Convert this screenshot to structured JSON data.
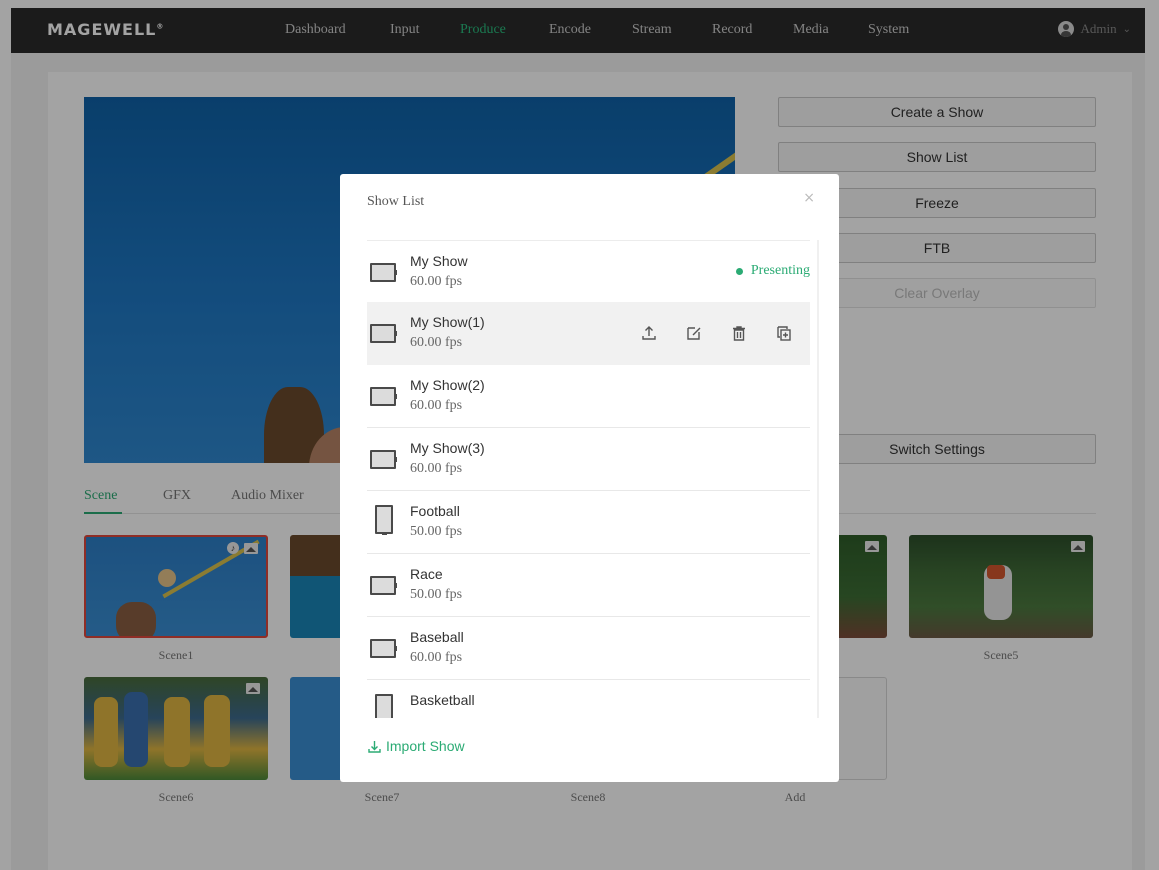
{
  "header": {
    "logo": "MAGEWELL",
    "logo_mark": "®",
    "nav": [
      {
        "label": "Dashboard",
        "active": false
      },
      {
        "label": "Input",
        "active": false
      },
      {
        "label": "Produce",
        "active": true
      },
      {
        "label": "Encode",
        "active": false
      },
      {
        "label": "Stream",
        "active": false
      },
      {
        "label": "Record",
        "active": false
      },
      {
        "label": "Media",
        "active": false
      },
      {
        "label": "System",
        "active": false
      }
    ],
    "user": "Admin"
  },
  "side_buttons": {
    "create_show": "Create a Show",
    "show_list": "Show List",
    "freeze": "Freeze",
    "ftb": "FTB",
    "clear_overlay": "Clear Overlay",
    "switch_settings": "Switch Settings"
  },
  "tabs": [
    "Scene",
    "GFX",
    "Audio Mixer"
  ],
  "scenes": {
    "scene1": "Scene1",
    "scene5": "Scene5",
    "scene6": "Scene6",
    "scene7": "Scene7",
    "scene8": "Scene8",
    "add": "Add"
  },
  "modal": {
    "title": "Show List",
    "close": "×",
    "presenting": "Presenting",
    "import": "Import Show",
    "shows": [
      {
        "name": "My Show",
        "fps": "60.00 fps",
        "orientation": "landscape"
      },
      {
        "name": "My Show(1)",
        "fps": "60.00 fps",
        "orientation": "landscape"
      },
      {
        "name": "My Show(2)",
        "fps": "60.00 fps",
        "orientation": "landscape"
      },
      {
        "name": "My Show(3)",
        "fps": "60.00 fps",
        "orientation": "landscape"
      },
      {
        "name": "Football",
        "fps": "50.00 fps",
        "orientation": "portrait"
      },
      {
        "name": "Race",
        "fps": "50.00 fps",
        "orientation": "landscape"
      },
      {
        "name": "Baseball",
        "fps": "60.00 fps",
        "orientation": "landscape"
      },
      {
        "name": "Basketball",
        "fps": "",
        "orientation": "portrait"
      }
    ]
  },
  "colors": {
    "accent": "#2bab74",
    "nav_bg": "#2b2b2b",
    "scene_selected_border": "#e0473c"
  }
}
